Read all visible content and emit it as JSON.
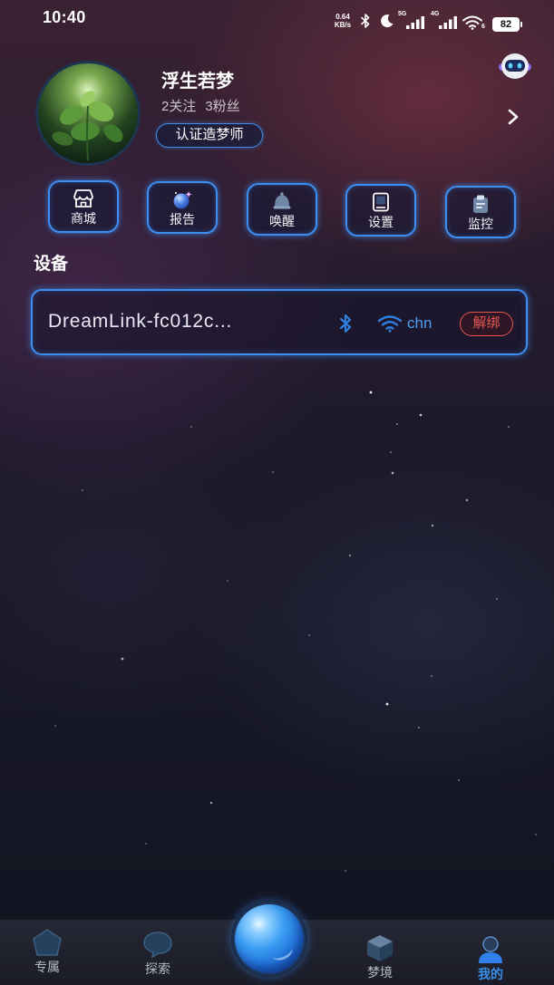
{
  "status_bar": {
    "time": "10:40",
    "net_speed_value": "0.64",
    "net_speed_unit": "KB/s",
    "signal_1_label": "5G",
    "signal_2_label": "4G",
    "wifi_badge": "6",
    "battery": "82",
    "icons": [
      "bluetooth-icon",
      "moon-icon",
      "cellular-signal-icon",
      "cellular-signal-icon",
      "wifi-icon",
      "battery-icon"
    ]
  },
  "assistant": {
    "icon": "robot-assistant-icon"
  },
  "profile": {
    "name": "浮生若梦",
    "following": "2关注",
    "followers": "3粉丝",
    "badge": "认证造梦师",
    "chevron_icon": "chevron-right-icon"
  },
  "quick_actions": [
    {
      "label": "商城",
      "icon": "store-icon"
    },
    {
      "label": "报告",
      "icon": "report-orb-icon"
    },
    {
      "label": "唤醒",
      "icon": "bell-icon"
    },
    {
      "label": "设置",
      "icon": "tablet-icon"
    },
    {
      "label": "监控",
      "icon": "clipboard-icon"
    }
  ],
  "devices": {
    "section_title": "设备",
    "items": [
      {
        "name": "DreamLink-fc012c...",
        "bluetooth_icon": "bluetooth-icon",
        "wifi_icon": "wifi-icon",
        "wifi_name": "chn",
        "unbind_label": "解绑"
      }
    ]
  },
  "bottom_nav": {
    "items": [
      {
        "label": "专属",
        "icon": "home-pentagon-icon",
        "active": false
      },
      {
        "label": "探索",
        "icon": "chat-bubble-icon",
        "active": false
      },
      {
        "label": "梦境",
        "icon": "cube-icon",
        "active": false
      },
      {
        "label": "我的",
        "icon": "person-icon",
        "active": true
      }
    ],
    "center_button": {
      "icon": "glowing-orb-icon"
    }
  },
  "colors": {
    "accent": "#3d8ef0",
    "unbind": "#e4574f",
    "bluetooth": "#2f7fe0",
    "nav_active": "#3a8fe8",
    "nav_inactive": "#b6bac6"
  }
}
